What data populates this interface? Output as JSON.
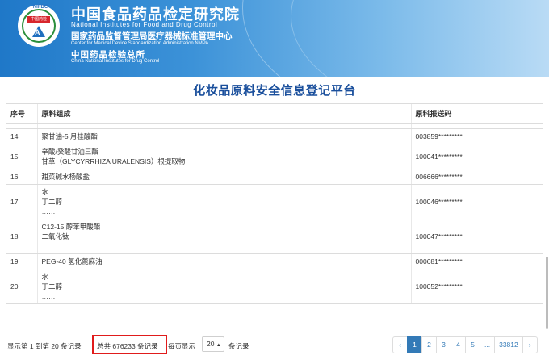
{
  "header": {
    "logo_top": "NIFDC",
    "logo_badge": "中国药检",
    "org_name_zh": "中国食品药品检定研究院",
    "org_name_en": "National Institutes for Food and Drug Control",
    "sub_name_zh": "国家药品监督管理局医疗器械标准管理中心",
    "sub_name_en": "Center for Medical Device Standardization Administration NMPA",
    "sub2_name_zh": "中国药品检验总所",
    "sub2_name_en": "China National Institutes for Drug Control"
  },
  "page_title": "化妆品原料安全信息登记平台",
  "table": {
    "headers": {
      "no": "序号",
      "composition": "原料组成",
      "code": "原料报送码"
    },
    "rows": [
      {
        "no": "14",
        "composition": [
          "聚甘油-5 月桂酸酯"
        ],
        "code": "003859*********"
      },
      {
        "no": "15",
        "composition": [
          "辛酸/癸酸甘油三酯",
          "甘草（GLYCYRRHIZA URALENSIS）根提取物"
        ],
        "code": "100041*********"
      },
      {
        "no": "16",
        "composition": [
          "甜菜碱水杨酸盐"
        ],
        "code": "006666*********"
      },
      {
        "no": "17",
        "composition": [
          "水",
          "丁二醇",
          "……"
        ],
        "code": "100046*********"
      },
      {
        "no": "18",
        "composition": [
          "C12-15 醇苯甲酸酯",
          "二氧化钛",
          "……"
        ],
        "code": "100047*********"
      },
      {
        "no": "19",
        "composition": [
          "PEG-40 氢化蓖麻油"
        ],
        "code": "000681*********"
      },
      {
        "no": "20",
        "composition": [
          "水",
          "丁二醇",
          "……"
        ],
        "code": "100052*********"
      }
    ]
  },
  "footer": {
    "range_text": "显示第 1 到第 20 条记录",
    "total_text": "总共 676233 条记录",
    "per_page_label": "每页显示",
    "per_page_value": "20",
    "per_page_suffix": "条记录",
    "pager": [
      "‹",
      "1",
      "2",
      "3",
      "4",
      "5",
      "...",
      "33812",
      "›"
    ],
    "active_page": "1"
  },
  "colors": {
    "title": "#1a4f9c",
    "highlight_box": "#e01b1b",
    "pager_active": "#337ab7",
    "banner": "#1f78c8"
  }
}
